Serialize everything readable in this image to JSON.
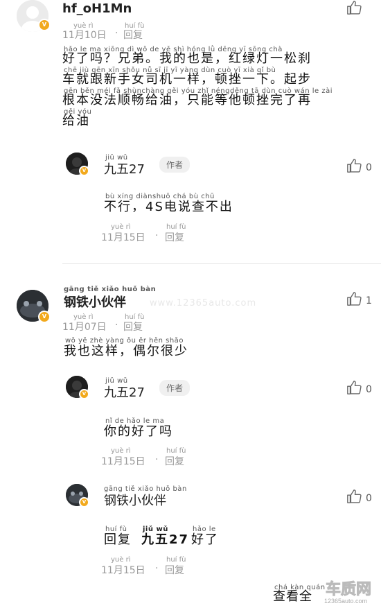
{
  "comments": [
    {
      "user": "hf_oH1Mn",
      "date": "11月10日",
      "date_pinyin": "yuè   rì",
      "reply_label": "回复",
      "reply_pinyin": "huí  fù",
      "text": "好了吗？兄弟。我的也是，红绿灯一松刹车就跟新手女司机一样，顿挫一下。起步根本没法顺畅给油，只能等他顿挫完了再给油",
      "text_pinyin_lines": [
        "hǎo  le   ma       xiōng  dì             wǒ   de   yě   shì           hóng  lǜ  dēng  yī  sōng chà",
        "chē  jiù  gēn  xīn shǒu  nǚ    sī    jī    yī  yàng        dùn  cuò   yī   xià           qǐ    bù",
        "gēn  běn  méi   fǎ  shùnchàng gěi  yóu        zhǐ néngděng  tā   dùn cuò wán  le  zài",
        "gěi yóu"
      ],
      "text_lines": [
        "好了吗？兄弟。我的也是，红绿灯一松刹",
        "车就跟新手女司机一样，顿挫一下。起步",
        "根本没法顺畅给油，只能等他顿挫完了再",
        "给油"
      ],
      "likes": "",
      "replies": [
        {
          "user": "九五27",
          "user_pinyin": "jiǔ  wǔ",
          "author_tag": "作者",
          "text": "不行，4S电说查不出",
          "text_pinyin": "bù xíng          diànshuō chá  bù  chū",
          "date": "11月15日",
          "date_pinyin": "yuè   rì",
          "reply_label": "回复",
          "reply_pinyin": "huí  fù",
          "likes": "0"
        }
      ]
    },
    {
      "user": "钢铁小伙伴",
      "user_pinyin": "gāng tiě  xiǎo huǒ bàn",
      "date": "11月07日",
      "date_pinyin": "yuè   rì",
      "reply_label": "回复",
      "reply_pinyin": "huí  fù",
      "text": "我也这样，偶尔很少",
      "text_pinyin": "wǒ  yě  zhè yàng        ǒu   ěr  hěn shǎo",
      "likes": "1",
      "replies": [
        {
          "user": "九五27",
          "user_pinyin": "jiǔ  wǔ",
          "author_tag": "作者",
          "text": "你的好了吗",
          "text_pinyin": "nǐ   de  hǎo  le   ma",
          "date": "11月15日",
          "date_pinyin": "yuè   rì",
          "reply_label": "回复",
          "reply_pinyin": "huí  fù",
          "likes": "0"
        },
        {
          "user": "钢铁小伙伴",
          "user_pinyin": "gāng tiě  xiǎo huǒ bàn",
          "text_prefix": "回复",
          "text_prefix_pinyin": "huí  fù",
          "mention": "九五27",
          "mention_pinyin": "jiǔ  wǔ",
          "text_suffix": "好了",
          "text_suffix_pinyin": "hǎo  le",
          "date": "11月15日",
          "date_pinyin": "yuè   rì",
          "reply_label": "回复",
          "reply_pinyin": "huí  fù",
          "likes": "0"
        }
      ]
    }
  ],
  "footer": {
    "view_all": "查看全",
    "view_all_pinyin": "chá  kàn quán"
  },
  "watermark": "www.12365auto.com",
  "brand_mark": "车质网",
  "brand_url": "12365auto.com",
  "colors": {
    "badge": "#f2a91c",
    "meta": "#999999",
    "divider": "#e6e6e6"
  },
  "icons": {
    "like": "thumbs-up-icon",
    "verified": "v-badge-icon"
  }
}
